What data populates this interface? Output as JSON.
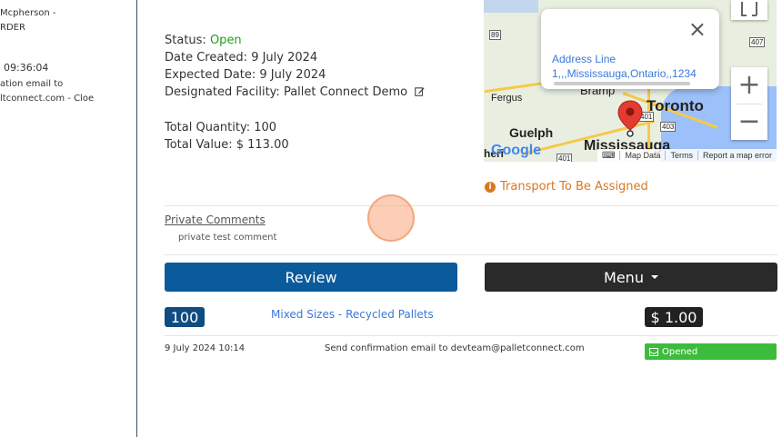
{
  "sidebar": {
    "lines": [
      "Mcpherson -",
      "RDER",
      "09:36:04",
      "ation email to",
      "ltconnect.com - Cloe"
    ]
  },
  "order": {
    "title_fragment": "",
    "status_label": "Status:",
    "status_value": "Open",
    "date_created_label": "Date Created:",
    "date_created_value": "9 July 2024",
    "expected_date_label": "Expected Date:",
    "expected_date_value": "9 July 2024",
    "facility_label": "Designated Facility:",
    "facility_value": "Pallet Connect Demo",
    "total_qty_label": "Total Quantity:",
    "total_qty_value": "100",
    "total_value_label": "Total Value:",
    "total_value_value": "$ 113.00"
  },
  "map": {
    "popup_line1": "Address Line",
    "popup_line2": "1,,,Mississauga,Ontario,,1234",
    "labels": {
      "toronto": "Toronto",
      "mississauga": "Mississauga",
      "guelph": "Guelph",
      "fergus": "Fergus",
      "brampton": "Bramp",
      "hwy89": "89",
      "hwy407": "407",
      "hwy401": "401",
      "hwy403": "403",
      "google": "Google",
      "cut_left": "heri"
    },
    "footer": [
      "Map Data",
      "Terms",
      "Report a map error"
    ],
    "zoom_in": "+",
    "zoom_out": "−",
    "close": "×"
  },
  "transport": "Transport To Be Assigned",
  "comments": {
    "label": "Private Comments",
    "text": "private test comment"
  },
  "buttons": {
    "review": "Review",
    "menu": "Menu"
  },
  "line_item": {
    "qty": "100",
    "product": "Mixed Sizes - Recycled Pallets",
    "price": "$ 1.00"
  },
  "log": {
    "time": "9 July 2024 10:14",
    "message": "Send confirmation email to devteam@palletconnect.com",
    "status": "Opened"
  },
  "colors": {
    "accent_blue": "#0b5a9b",
    "open_green": "#1e9e1e",
    "transport_orange": "#d9771f",
    "opened_green": "#3dbb3d"
  }
}
